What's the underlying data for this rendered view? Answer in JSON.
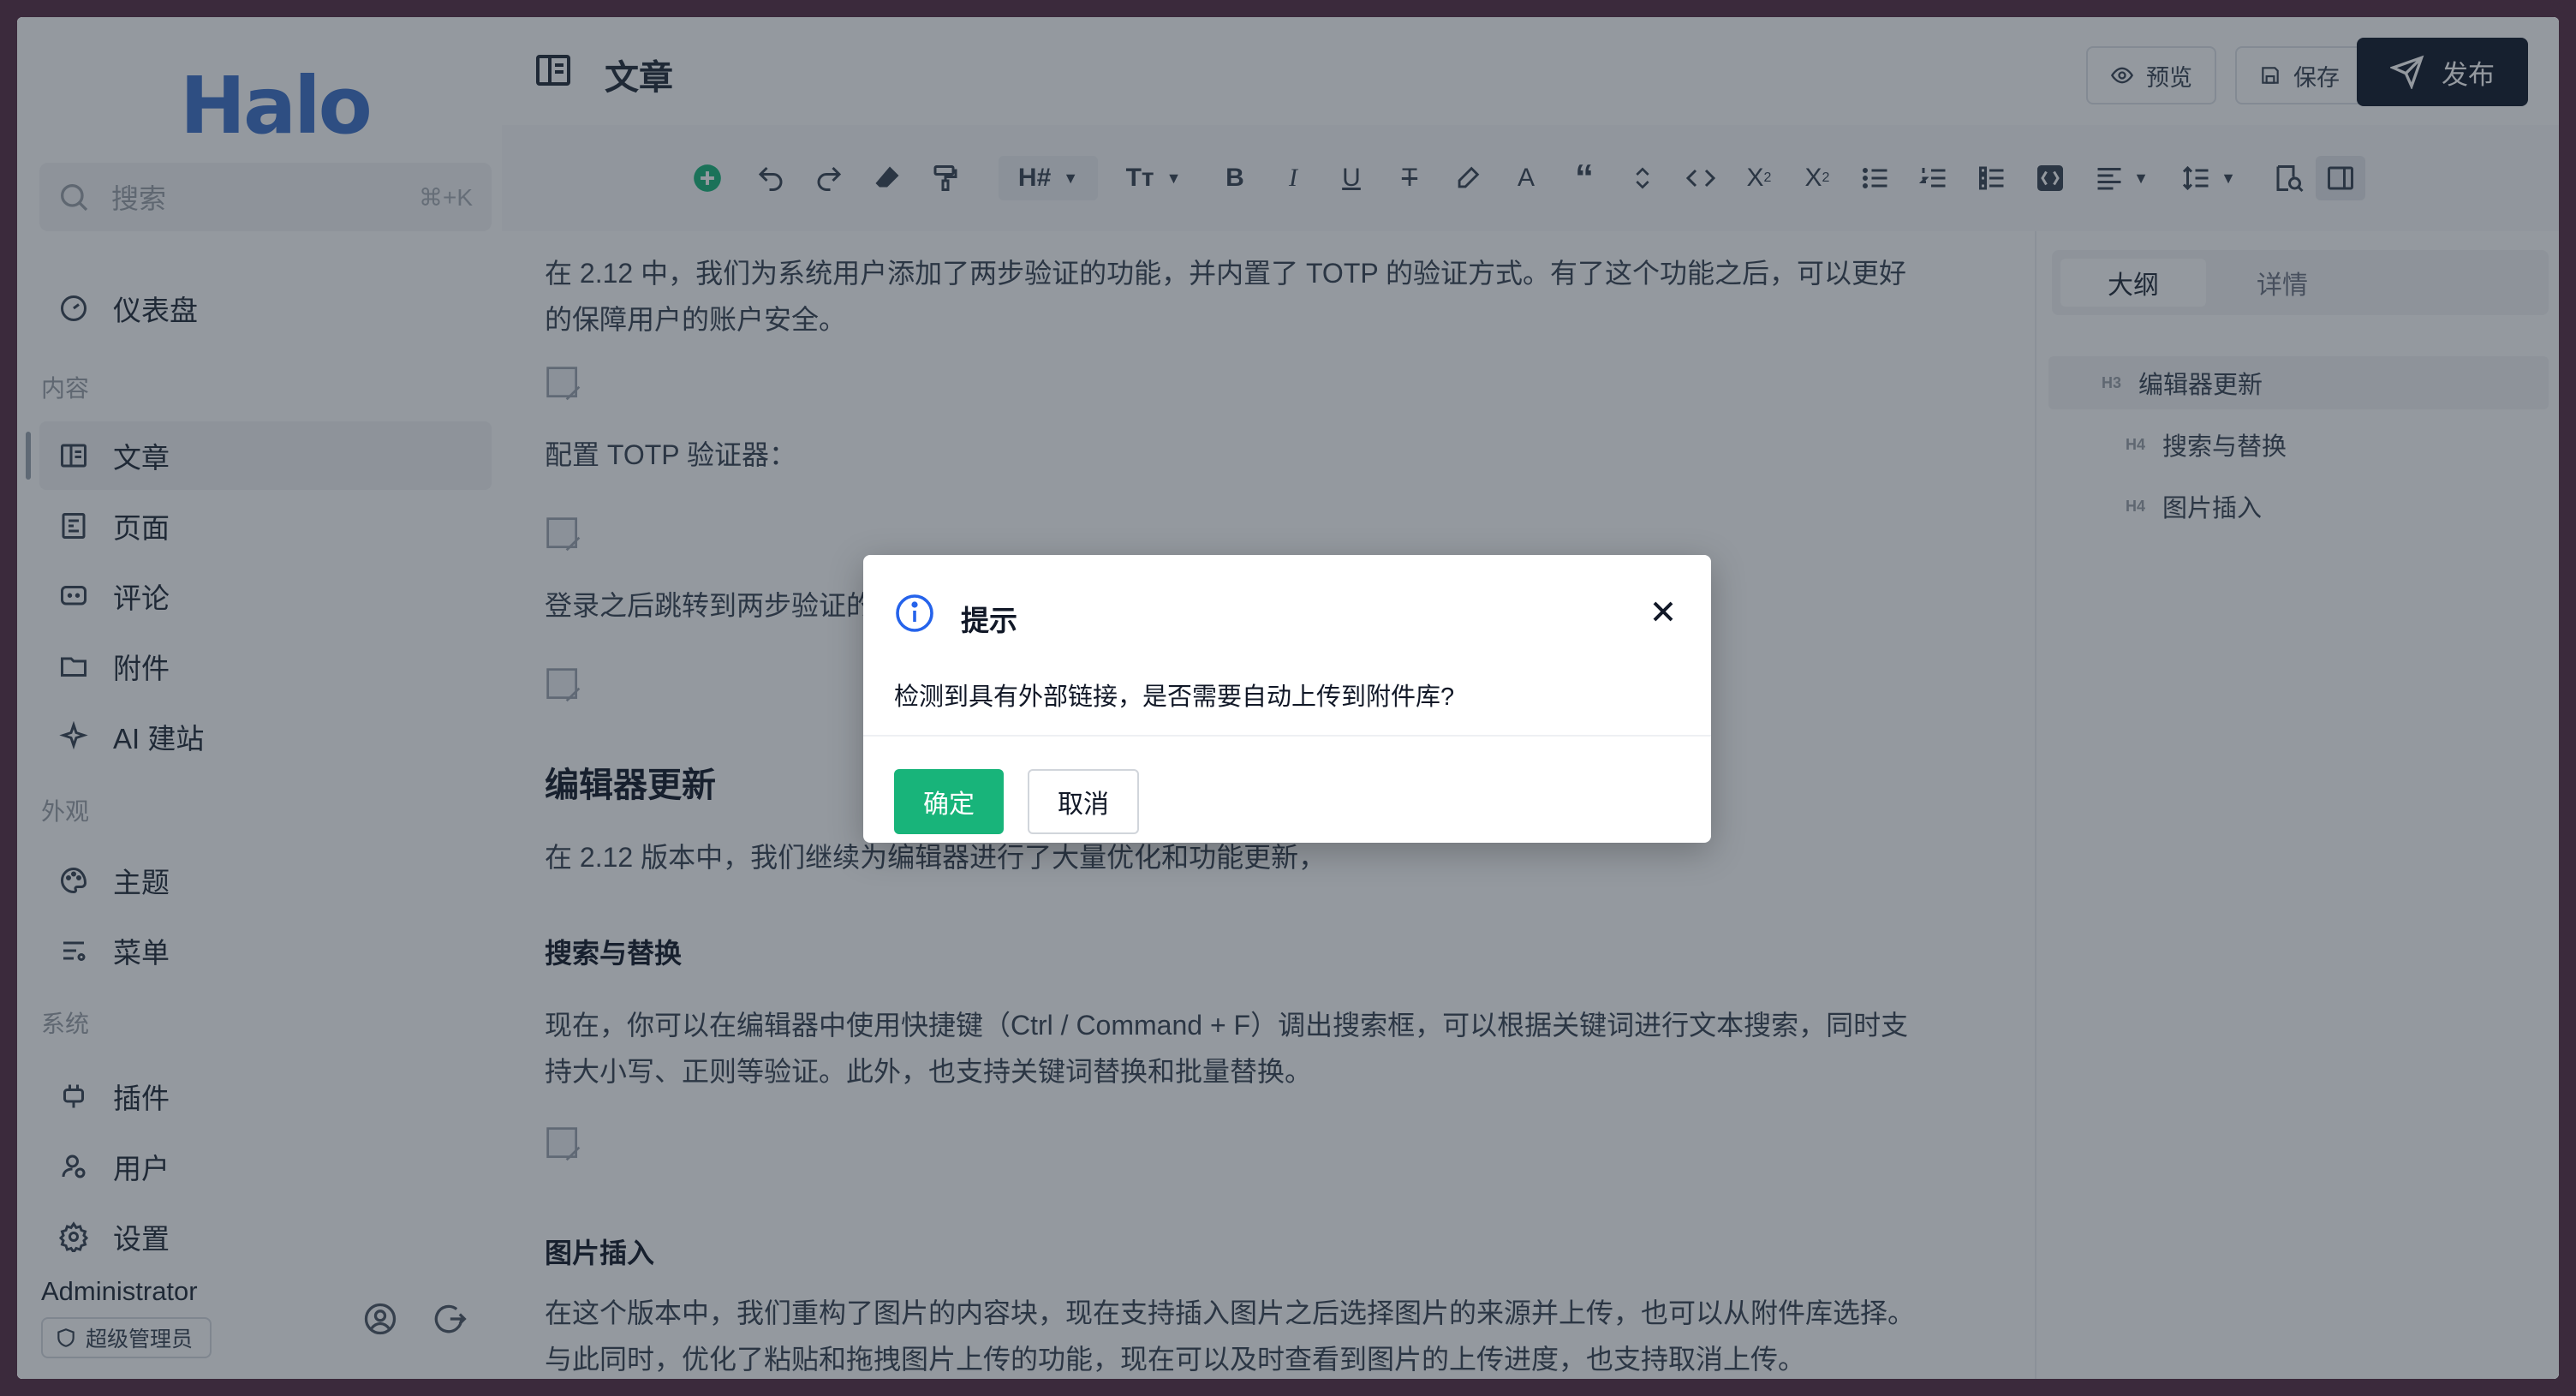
{
  "app": {
    "logo": "Halo"
  },
  "sidebar": {
    "search_placeholder": "搜索",
    "search_shortcut": "⌘+K",
    "dashboard": "仪表盘",
    "groups": {
      "content": "内容",
      "appearance": "外观",
      "system": "系统"
    },
    "items": {
      "posts": "文章",
      "pages": "页面",
      "comments": "评论",
      "attachments": "附件",
      "ai": "AI 建站",
      "themes": "主题",
      "menus": "菜单",
      "plugins": "插件",
      "users": "用户",
      "settings": "设置"
    },
    "user": {
      "name": "Administrator",
      "role": "超级管理员"
    }
  },
  "header": {
    "title": "文章",
    "preview": "预览",
    "save": "保存",
    "publish": "发布"
  },
  "toolbar": {
    "heading": "H#",
    "font": "Tт"
  },
  "editor": {
    "p1_line1": "在 2.12 中，我们为系统用户添加了两步验证的功能，并内置了 TOTP 的验证方式。有了这个功能之后，可以更好",
    "p1_line2": "的保障用户的账户安全。",
    "p2": "配置 TOTP 验证器：",
    "p3": "登录之后跳转到两步验证的",
    "h3": "编辑器更新",
    "p4": "在 2.12 版本中，我们继续为编辑器进行了大量优化和功能更新，",
    "h4_search": "搜索与替换",
    "p5_line1": "现在，你可以在编辑器中使用快捷键（Ctrl / Command + F）调出搜索框，可以根据关键词进行文本搜索，同时支",
    "p5_line2": "持大小写、正则等验证。此外，也支持关键词替换和批量替换。",
    "h4_image": "图片插入",
    "p6_line1": "在这个版本中，我们重构了图片的内容块，现在支持插入图片之后选择图片的来源并上传，也可以从附件库选择。",
    "p6_line2": "与此同时，优化了粘贴和拖拽图片上传的功能，现在可以及时查看到图片的上传进度，也支持取消上传。"
  },
  "right_panel": {
    "tab_outline": "大纲",
    "tab_detail": "详情",
    "outline": [
      {
        "level": "H3",
        "text": "编辑器更新"
      },
      {
        "level": "H4",
        "text": "搜索与替换"
      },
      {
        "level": "H4",
        "text": "图片插入"
      }
    ]
  },
  "dialog": {
    "title": "提示",
    "message": "检测到具有外部链接，是否需要自动上传到附件库?",
    "confirm": "确定",
    "cancel": "取消"
  },
  "colors": {
    "accent": "#18b47a",
    "logo": "#3c6fc7",
    "publish_bg": "#0f172a"
  }
}
